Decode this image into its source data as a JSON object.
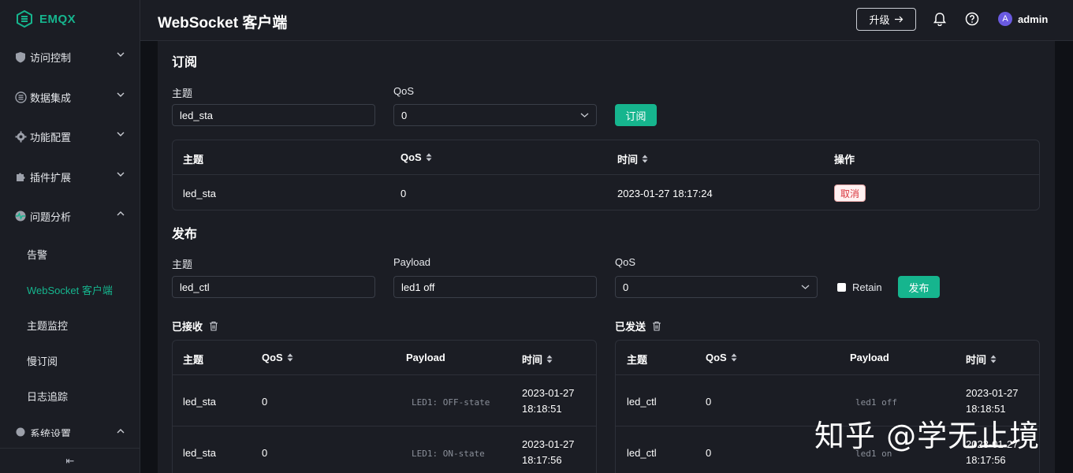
{
  "app": {
    "logo_text": "EMQX",
    "page_title": "WebSocket 客户端",
    "upgrade_label": "升级",
    "user_initial": "A",
    "user_name": "admin"
  },
  "sidebar": {
    "groups": [
      {
        "label": "访问控制",
        "icon": "shield-icon"
      },
      {
        "label": "数据集成",
        "icon": "data-icon"
      },
      {
        "label": "功能配置",
        "icon": "gear-icon"
      },
      {
        "label": "插件扩展",
        "icon": "puzzle-icon"
      },
      {
        "label": "问题分析",
        "icon": "pulse-icon"
      }
    ],
    "sub_items": [
      "告警",
      "WebSocket 客户端",
      "主题监控",
      "慢订阅",
      "日志追踪"
    ],
    "partial_group": "系统设置",
    "footer_toggle": "⇤"
  },
  "subscribe": {
    "title": "订阅",
    "topic_label": "主题",
    "topic_value": "led_sta",
    "qos_label": "QoS",
    "qos_value": "0",
    "button": "订阅",
    "columns": [
      "主题",
      "QoS",
      "时间",
      "操作"
    ],
    "rows": [
      {
        "topic": "led_sta",
        "qos": "0",
        "time": "2023-01-27 18:17:24",
        "action": "取消"
      }
    ]
  },
  "publish": {
    "title": "发布",
    "topic_label": "主题",
    "topic_value": "led_ctl",
    "payload_label": "Payload",
    "payload_value": "led1 off",
    "qos_label": "QoS",
    "qos_value": "0",
    "retain_label": "Retain",
    "button": "发布"
  },
  "received": {
    "title": "已接收",
    "columns": [
      "主题",
      "QoS",
      "Payload",
      "时间"
    ],
    "rows": [
      {
        "topic": "led_sta",
        "qos": "0",
        "payload": "LED1: OFF-state",
        "date": "2023-01-27",
        "time": "18:18:51"
      },
      {
        "topic": "led_sta",
        "qos": "0",
        "payload": "LED1: ON-state",
        "date": "2023-01-27",
        "time": "18:17:56"
      }
    ]
  },
  "sent": {
    "title": "已发送",
    "columns": [
      "主题",
      "QoS",
      "Payload",
      "时间"
    ],
    "rows": [
      {
        "topic": "led_ctl",
        "qos": "0",
        "payload": "led1 off",
        "date": "2023-01-27",
        "time": "18:18:51"
      },
      {
        "topic": "led_ctl",
        "qos": "0",
        "payload": "led1 on",
        "date": "2023-01-27",
        "time": "18:17:56"
      }
    ]
  },
  "watermark": "知乎 @学无止境",
  "colors": {
    "accent": "#16b58e",
    "background": "#1b1d24",
    "danger": "#d9363e"
  }
}
